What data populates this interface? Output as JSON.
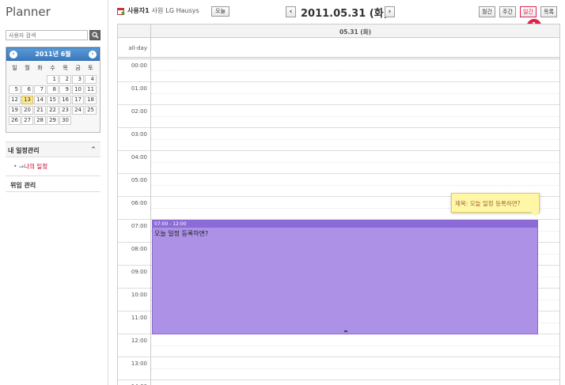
{
  "app": {
    "title": "Planner"
  },
  "sidebar": {
    "search_placeholder": "사용자 검색",
    "mini_calendar": {
      "title": "2011년 6월",
      "prev": "‹",
      "next": "›",
      "weekdays": [
        "일",
        "월",
        "화",
        "수",
        "목",
        "금",
        "토"
      ],
      "weeks": [
        [
          "",
          "",
          "",
          "1",
          "2",
          "3",
          "4"
        ],
        [
          "5",
          "6",
          "7",
          "8",
          "9",
          "10",
          "11"
        ],
        [
          "12",
          "13",
          "14",
          "15",
          "16",
          "17",
          "18"
        ],
        [
          "19",
          "20",
          "21",
          "22",
          "23",
          "24",
          "25"
        ],
        [
          "26",
          "27",
          "28",
          "29",
          "30",
          "",
          ""
        ]
      ],
      "highlighted": "13"
    },
    "my_schedule": {
      "label": "내 일정관리",
      "chevron": "^"
    },
    "my_schedule_item": {
      "bullet": "•",
      "arrow": "⇒",
      "label": "나의 일정"
    },
    "delegate": {
      "label": "위임 관리"
    }
  },
  "topbar": {
    "user_name": "사용자1",
    "user_rank": "사원",
    "user_company": "LG Hausys",
    "today_label": "오늘",
    "prev": "‹",
    "next": "›",
    "date_title": "2011.05.31 (화)",
    "views": {
      "month": "월간",
      "week": "주간",
      "day": "일간",
      "list": "목록"
    },
    "active_view": "일간",
    "badge": "1"
  },
  "calendar": {
    "day_header": "05.31 (화)",
    "allday_label": "all-day",
    "hours": [
      "00:00",
      "01:00",
      "02:00",
      "03:00",
      "04:00",
      "05:00",
      "06:00",
      "07:00",
      "08:00",
      "09:00",
      "10:00",
      "11:00",
      "12:00",
      "13:00",
      "14:00"
    ],
    "event": {
      "time": "07:00 - 12:00",
      "title": "오늘 일정 등록하면?",
      "color": "#ac91e6"
    },
    "tooltip": "제목: 오늘 일정 등록하면?"
  },
  "colors": {
    "accent": "#e0204a",
    "header_blue": "#3b79bd",
    "event_purple": "#ac91e6"
  }
}
